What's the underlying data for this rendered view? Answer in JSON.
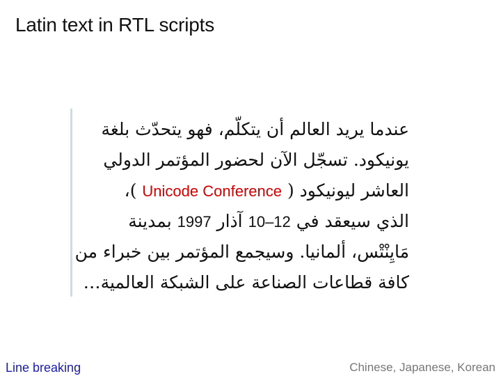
{
  "slide": {
    "title": "Latin text in RTL scripts"
  },
  "content": {
    "line1": "عندما يريد العالم أن يتكلّم، فهو يتحدّث بلغة",
    "line2": "يونيكود. تسجّل الآن لحضور المؤتمر الدولي",
    "line3_before": "العاشر ليونيكود (",
    "line3_latin": "Unicode Conference",
    "line3_after": ")،",
    "line4_part1": "الذي سيعقد في",
    "line4_range": "10–12",
    "line4_part2": "آذار",
    "line4_year": "1997",
    "line4_part3": "بمدينة",
    "line5": "مَايِنْتْس، ألمانيا. وسيجمع المؤتمر بين خبراء من",
    "line6": "كافة قطاعات الصناعة على الشبكة العالمية…"
  },
  "footer": {
    "left_link": "Line breaking",
    "right_link": "Chinese, Japanese, Korean"
  },
  "colors": {
    "latin_highlight": "#d40000",
    "quote_bar": "#c7dcef",
    "footer_left": "#1a1ab0",
    "footer_right": "#777777"
  }
}
